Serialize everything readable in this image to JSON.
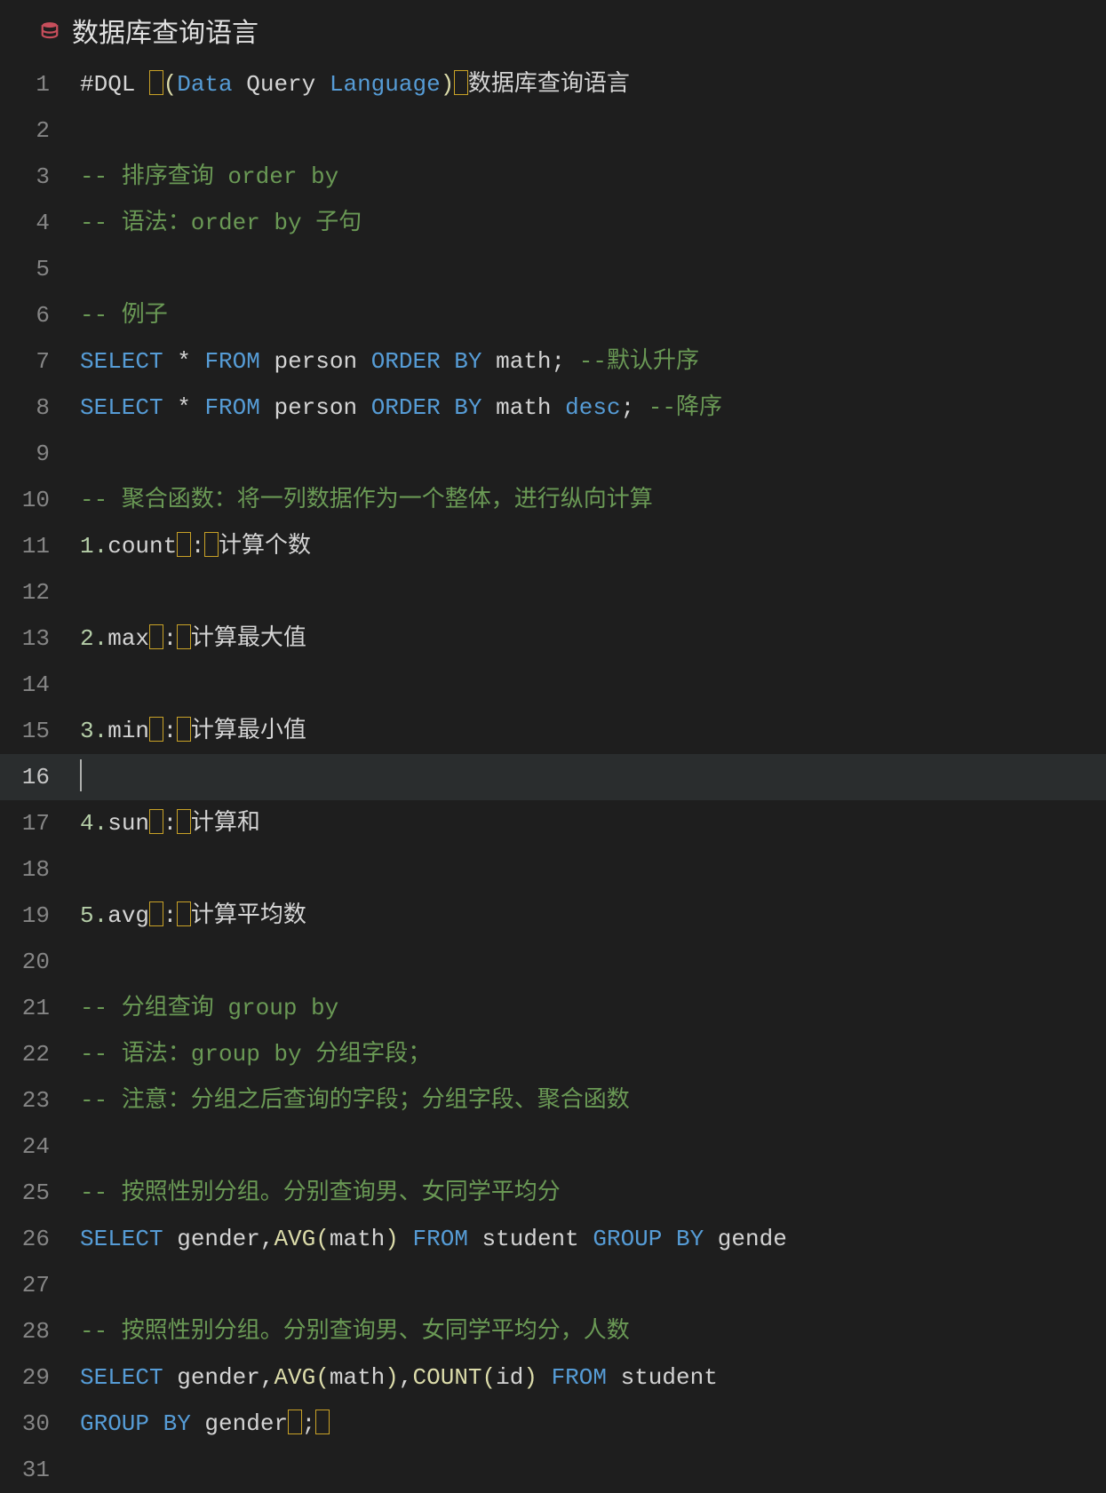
{
  "tab": {
    "icon": "database-icon",
    "title": "数据库查询语言"
  },
  "active_line": 16,
  "lines": [
    {
      "n": 1,
      "tokens": [
        {
          "c": "plain",
          "t": "#DQL "
        },
        {
          "c": "hlspace"
        },
        {
          "c": "paren",
          "t": "("
        },
        {
          "c": "keyword",
          "t": "Data"
        },
        {
          "c": "plain",
          "t": " Query "
        },
        {
          "c": "keyword",
          "t": "Language"
        },
        {
          "c": "paren",
          "t": ")"
        },
        {
          "c": "hlspace"
        },
        {
          "c": "plain",
          "t": "数据库查询语言"
        }
      ]
    },
    {
      "n": 2,
      "tokens": []
    },
    {
      "n": 3,
      "tokens": [
        {
          "c": "comment",
          "t": "-- 排序查询 order by"
        }
      ]
    },
    {
      "n": 4,
      "tokens": [
        {
          "c": "comment",
          "t": "-- 语法：order by 子句"
        }
      ]
    },
    {
      "n": 5,
      "tokens": []
    },
    {
      "n": 6,
      "tokens": [
        {
          "c": "comment",
          "t": "-- 例子"
        }
      ]
    },
    {
      "n": 7,
      "tokens": [
        {
          "c": "keyword",
          "t": "SELECT"
        },
        {
          "c": "plain",
          "t": " * "
        },
        {
          "c": "keyword",
          "t": "FROM"
        },
        {
          "c": "plain",
          "t": " person "
        },
        {
          "c": "keyword",
          "t": "ORDER BY"
        },
        {
          "c": "plain",
          "t": " math; "
        },
        {
          "c": "comment",
          "t": "--默认升序"
        }
      ]
    },
    {
      "n": 8,
      "tokens": [
        {
          "c": "keyword",
          "t": "SELECT"
        },
        {
          "c": "plain",
          "t": " * "
        },
        {
          "c": "keyword",
          "t": "FROM"
        },
        {
          "c": "plain",
          "t": " person "
        },
        {
          "c": "keyword",
          "t": "ORDER BY"
        },
        {
          "c": "plain",
          "t": " math "
        },
        {
          "c": "keyword",
          "t": "desc"
        },
        {
          "c": "plain",
          "t": "; "
        },
        {
          "c": "comment",
          "t": "--降序"
        }
      ]
    },
    {
      "n": 9,
      "tokens": []
    },
    {
      "n": 10,
      "tokens": [
        {
          "c": "comment",
          "t": "-- 聚合函数：将一列数据作为一个整体，进行纵向计算"
        }
      ]
    },
    {
      "n": 11,
      "tokens": [
        {
          "c": "number",
          "t": "1."
        },
        {
          "c": "plain",
          "t": "count"
        },
        {
          "c": "hlspace"
        },
        {
          "c": "plain",
          "t": ":"
        },
        {
          "c": "hlspace"
        },
        {
          "c": "plain",
          "t": "计算个数"
        }
      ]
    },
    {
      "n": 12,
      "tokens": []
    },
    {
      "n": 13,
      "tokens": [
        {
          "c": "number",
          "t": "2."
        },
        {
          "c": "plain",
          "t": "max"
        },
        {
          "c": "hlspace"
        },
        {
          "c": "plain",
          "t": ":"
        },
        {
          "c": "hlspace"
        },
        {
          "c": "plain",
          "t": "计算最大值"
        }
      ]
    },
    {
      "n": 14,
      "tokens": []
    },
    {
      "n": 15,
      "tokens": [
        {
          "c": "number",
          "t": "3."
        },
        {
          "c": "plain",
          "t": "min"
        },
        {
          "c": "hlspace"
        },
        {
          "c": "plain",
          "t": ":"
        },
        {
          "c": "hlspace"
        },
        {
          "c": "plain",
          "t": "计算最小值"
        }
      ]
    },
    {
      "n": 16,
      "tokens": [
        {
          "c": "cursor"
        }
      ]
    },
    {
      "n": 17,
      "tokens": [
        {
          "c": "number",
          "t": "4."
        },
        {
          "c": "plain",
          "t": "sun"
        },
        {
          "c": "hlspace"
        },
        {
          "c": "plain",
          "t": ":"
        },
        {
          "c": "hlspace"
        },
        {
          "c": "plain",
          "t": "计算和"
        }
      ]
    },
    {
      "n": 18,
      "tokens": []
    },
    {
      "n": 19,
      "tokens": [
        {
          "c": "number",
          "t": "5."
        },
        {
          "c": "plain",
          "t": "avg"
        },
        {
          "c": "hlspace"
        },
        {
          "c": "plain",
          "t": ":"
        },
        {
          "c": "hlspace"
        },
        {
          "c": "plain",
          "t": "计算平均数"
        }
      ]
    },
    {
      "n": 20,
      "tokens": []
    },
    {
      "n": 21,
      "tokens": [
        {
          "c": "comment",
          "t": "-- 分组查询 group by"
        }
      ]
    },
    {
      "n": 22,
      "tokens": [
        {
          "c": "comment",
          "t": "-- 语法：group by 分组字段；"
        }
      ]
    },
    {
      "n": 23,
      "tokens": [
        {
          "c": "comment",
          "t": "-- 注意：分组之后查询的字段；分组字段、聚合函数"
        }
      ]
    },
    {
      "n": 24,
      "tokens": []
    },
    {
      "n": 25,
      "tokens": [
        {
          "c": "comment",
          "t": "-- 按照性别分组。分别查询男、女同学平均分"
        }
      ]
    },
    {
      "n": 26,
      "tokens": [
        {
          "c": "keyword",
          "t": "SELECT"
        },
        {
          "c": "plain",
          "t": " gender,"
        },
        {
          "c": "fn",
          "t": "AVG"
        },
        {
          "c": "paren",
          "t": "("
        },
        {
          "c": "plain",
          "t": "math"
        },
        {
          "c": "paren",
          "t": ")"
        },
        {
          "c": "plain",
          "t": " "
        },
        {
          "c": "keyword",
          "t": "FROM"
        },
        {
          "c": "plain",
          "t": " student "
        },
        {
          "c": "keyword",
          "t": "GROUP BY"
        },
        {
          "c": "plain",
          "t": " gende"
        }
      ]
    },
    {
      "n": 27,
      "tokens": []
    },
    {
      "n": 28,
      "tokens": [
        {
          "c": "comment",
          "t": "-- 按照性别分组。分别查询男、女同学平均分，人数"
        }
      ]
    },
    {
      "n": 29,
      "tokens": [
        {
          "c": "keyword",
          "t": "SELECT"
        },
        {
          "c": "plain",
          "t": " gender,"
        },
        {
          "c": "fn",
          "t": "AVG"
        },
        {
          "c": "paren",
          "t": "("
        },
        {
          "c": "plain",
          "t": "math"
        },
        {
          "c": "paren",
          "t": ")"
        },
        {
          "c": "plain",
          "t": ","
        },
        {
          "c": "fn",
          "t": "COUNT"
        },
        {
          "c": "paren",
          "t": "("
        },
        {
          "c": "plain",
          "t": "id"
        },
        {
          "c": "paren",
          "t": ")"
        },
        {
          "c": "plain",
          "t": " "
        },
        {
          "c": "keyword",
          "t": "FROM"
        },
        {
          "c": "plain",
          "t": " student"
        }
      ]
    },
    {
      "n": 30,
      "tokens": [
        {
          "c": "keyword",
          "t": "GROUP BY"
        },
        {
          "c": "plain",
          "t": " gender"
        },
        {
          "c": "hlspace"
        },
        {
          "c": "plain",
          "t": ";"
        },
        {
          "c": "hlspace"
        }
      ]
    },
    {
      "n": 31,
      "tokens": []
    }
  ]
}
